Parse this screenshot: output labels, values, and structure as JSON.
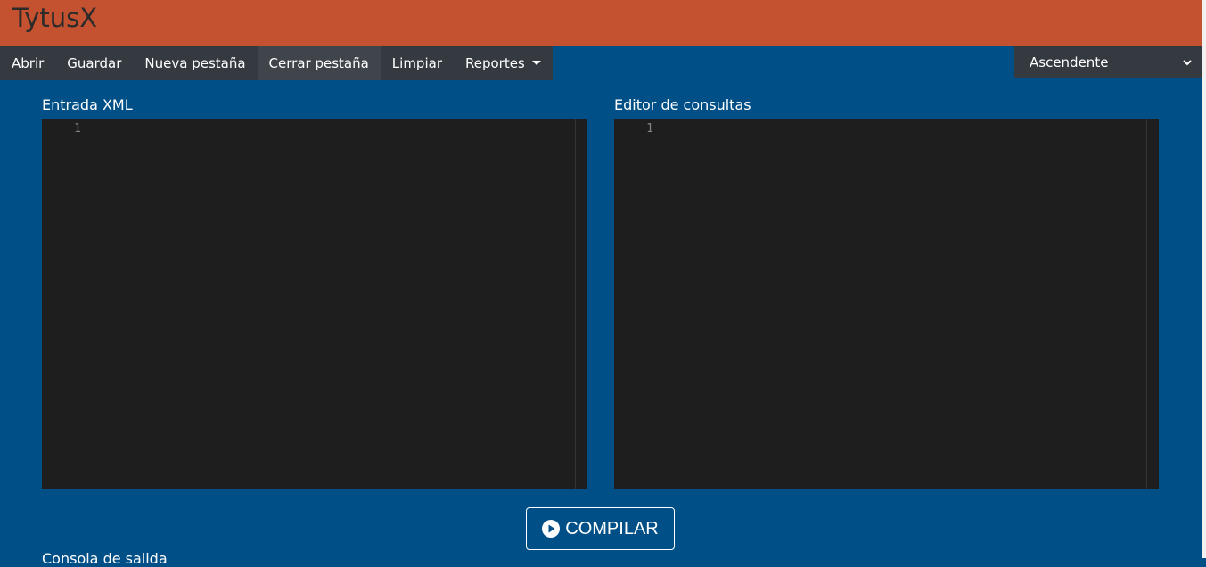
{
  "app": {
    "title": "TytusX"
  },
  "toolbar": {
    "items": [
      {
        "label": "Abrir"
      },
      {
        "label": "Guardar"
      },
      {
        "label": "Nueva pestaña"
      },
      {
        "label": "Cerrar pestaña"
      },
      {
        "label": "Limpiar"
      },
      {
        "label": "Reportes"
      }
    ]
  },
  "order_select": {
    "value": "Ascendente",
    "icon": "chevron-down-icon"
  },
  "xml_editor": {
    "label": "Entrada XML",
    "line_number": "1"
  },
  "query_editor": {
    "label": "Editor de consultas",
    "line_number": "1"
  },
  "compile_button": {
    "label": "COMPILAR",
    "icon": "play-circle-icon"
  },
  "output": {
    "label": "Consola de salida"
  },
  "colors": {
    "header": "#c4512f",
    "background": "#004f86",
    "toolbar": "#343a40",
    "editor": "#1e1e1e"
  }
}
